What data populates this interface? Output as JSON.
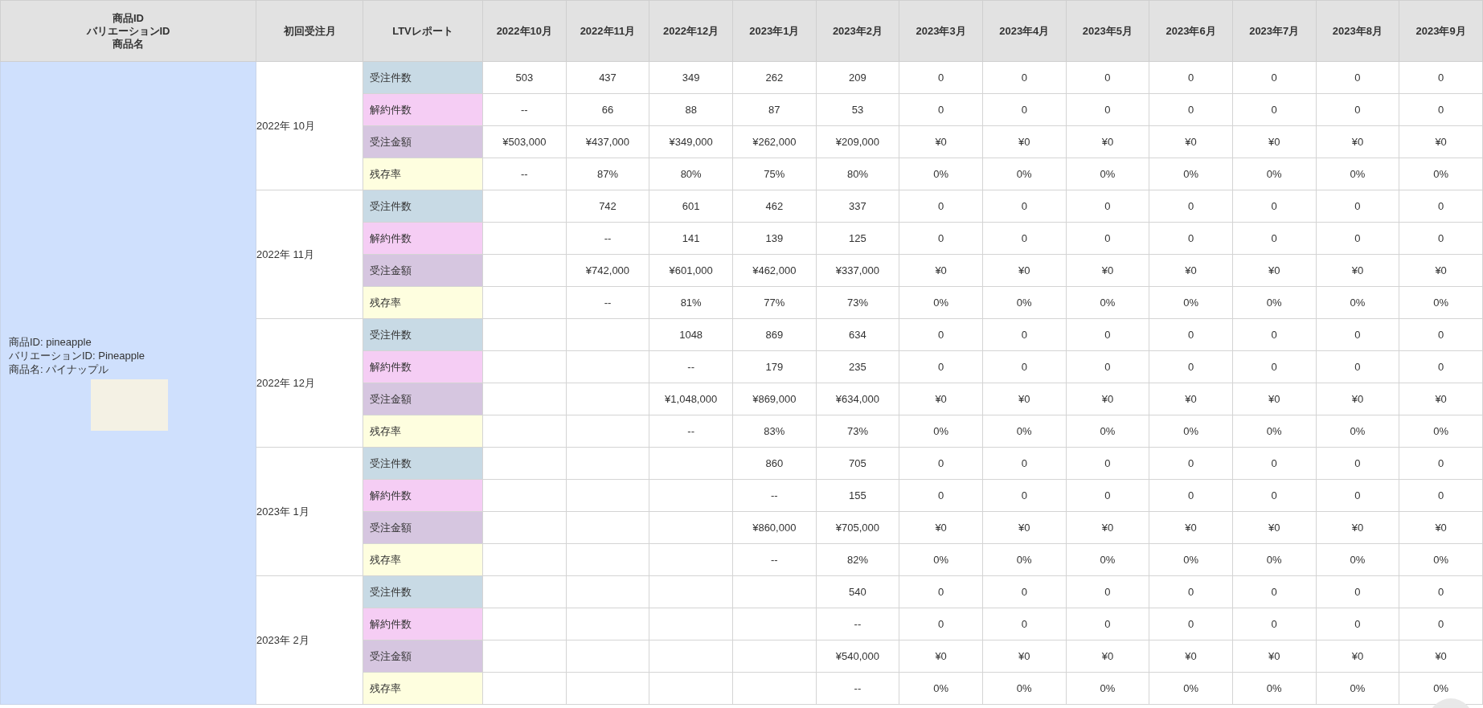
{
  "table": {
    "columns": [
      "商品ID\nバリエーションID\n商品名",
      "初回受注月",
      "LTVレポート",
      "2022年10月",
      "2022年11月",
      "2022年12月",
      "2023年1月",
      "2023年2月",
      "2023年3月",
      "2023年4月",
      "2023年5月",
      "2023年6月",
      "2023年7月",
      "2023年8月",
      "2023年9月"
    ],
    "product": {
      "lines": [
        "商品ID: pineapple",
        "バリエーションID: Pineapple",
        "商品名: パイナップル"
      ]
    },
    "cohorts": [
      {
        "month": "2022年 10月",
        "metrics": [
          {
            "kind": "orders",
            "label": "受注件数",
            "values": [
              "503",
              "437",
              "349",
              "262",
              "209",
              "0",
              "0",
              "0",
              "0",
              "0",
              "0",
              "0"
            ]
          },
          {
            "kind": "cancellations",
            "label": "解約件数",
            "values": [
              "--",
              "66",
              "88",
              "87",
              "53",
              "0",
              "0",
              "0",
              "0",
              "0",
              "0",
              "0"
            ]
          },
          {
            "kind": "amount",
            "label": "受注金額",
            "values": [
              "¥503,000",
              "¥437,000",
              "¥349,000",
              "¥262,000",
              "¥209,000",
              "¥0",
              "¥0",
              "¥0",
              "¥0",
              "¥0",
              "¥0",
              "¥0"
            ]
          },
          {
            "kind": "retention",
            "label": "残存率",
            "values": [
              "--",
              "87%",
              "80%",
              "75%",
              "80%",
              "0%",
              "0%",
              "0%",
              "0%",
              "0%",
              "0%",
              "0%"
            ]
          }
        ]
      },
      {
        "month": "2022年 11月",
        "metrics": [
          {
            "kind": "orders",
            "label": "受注件数",
            "values": [
              "742",
              "601",
              "462",
              "337",
              "0",
              "0",
              "0",
              "0",
              "0",
              "0",
              "0"
            ]
          },
          {
            "kind": "cancellations",
            "label": "解約件数",
            "values": [
              "--",
              "141",
              "139",
              "125",
              "0",
              "0",
              "0",
              "0",
              "0",
              "0",
              "0"
            ]
          },
          {
            "kind": "amount",
            "label": "受注金額",
            "values": [
              "¥742,000",
              "¥601,000",
              "¥462,000",
              "¥337,000",
              "¥0",
              "¥0",
              "¥0",
              "¥0",
              "¥0",
              "¥0",
              "¥0"
            ]
          },
          {
            "kind": "retention",
            "label": "残存率",
            "values": [
              "--",
              "81%",
              "77%",
              "73%",
              "0%",
              "0%",
              "0%",
              "0%",
              "0%",
              "0%",
              "0%"
            ]
          }
        ]
      },
      {
        "month": "2022年 12月",
        "metrics": [
          {
            "kind": "orders",
            "label": "受注件数",
            "values": [
              "1048",
              "869",
              "634",
              "0",
              "0",
              "0",
              "0",
              "0",
              "0",
              "0"
            ]
          },
          {
            "kind": "cancellations",
            "label": "解約件数",
            "values": [
              "--",
              "179",
              "235",
              "0",
              "0",
              "0",
              "0",
              "0",
              "0",
              "0"
            ]
          },
          {
            "kind": "amount",
            "label": "受注金額",
            "values": [
              "¥1,048,000",
              "¥869,000",
              "¥634,000",
              "¥0",
              "¥0",
              "¥0",
              "¥0",
              "¥0",
              "¥0",
              "¥0"
            ]
          },
          {
            "kind": "retention",
            "label": "残存率",
            "values": [
              "--",
              "83%",
              "73%",
              "0%",
              "0%",
              "0%",
              "0%",
              "0%",
              "0%",
              "0%"
            ]
          }
        ]
      },
      {
        "month": "2023年 1月",
        "metrics": [
          {
            "kind": "orders",
            "label": "受注件数",
            "values": [
              "860",
              "705",
              "0",
              "0",
              "0",
              "0",
              "0",
              "0",
              "0"
            ]
          },
          {
            "kind": "cancellations",
            "label": "解約件数",
            "values": [
              "--",
              "155",
              "0",
              "0",
              "0",
              "0",
              "0",
              "0",
              "0"
            ]
          },
          {
            "kind": "amount",
            "label": "受注金額",
            "values": [
              "¥860,000",
              "¥705,000",
              "¥0",
              "¥0",
              "¥0",
              "¥0",
              "¥0",
              "¥0",
              "¥0"
            ]
          },
          {
            "kind": "retention",
            "label": "残存率",
            "values": [
              "--",
              "82%",
              "0%",
              "0%",
              "0%",
              "0%",
              "0%",
              "0%",
              "0%"
            ]
          }
        ]
      },
      {
        "month": "2023年 2月",
        "metrics": [
          {
            "kind": "orders",
            "label": "受注件数",
            "values": [
              "540",
              "0",
              "0",
              "0",
              "0",
              "0",
              "0",
              "0"
            ]
          },
          {
            "kind": "cancellations",
            "label": "解約件数",
            "values": [
              "--",
              "0",
              "0",
              "0",
              "0",
              "0",
              "0",
              "0"
            ]
          },
          {
            "kind": "amount",
            "label": "受注金額",
            "values": [
              "¥540,000",
              "¥0",
              "¥0",
              "¥0",
              "¥0",
              "¥0",
              "¥0",
              "¥0"
            ]
          },
          {
            "kind": "retention",
            "label": "残存率",
            "values": [
              "--",
              "0%",
              "0%",
              "0%",
              "0%",
              "0%",
              "0%",
              "0%"
            ]
          }
        ]
      }
    ]
  }
}
